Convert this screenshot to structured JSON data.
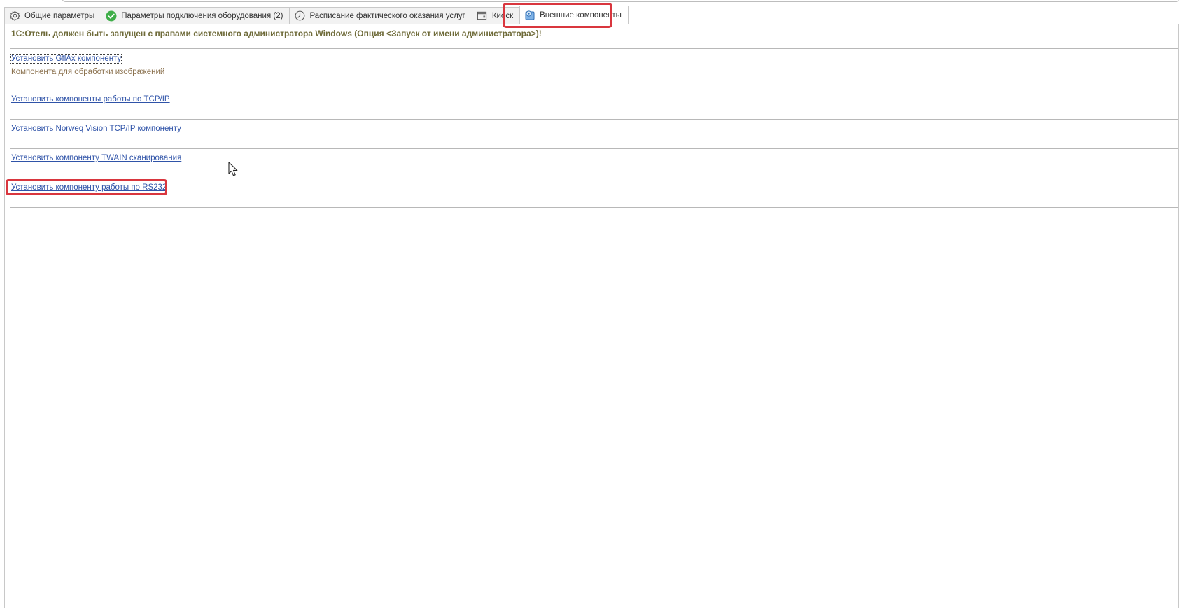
{
  "tabs": [
    {
      "label": "Общие параметры",
      "icon": "gear-icon",
      "active": false
    },
    {
      "label": "Параметры подключения оборудования (2)",
      "icon": "check-circle-icon",
      "active": false
    },
    {
      "label": "Расписание фактического оказания услуг",
      "icon": "clock-icon",
      "active": false
    },
    {
      "label": "Киоск",
      "icon": "window-icon",
      "active": false
    },
    {
      "label": "Внешние компоненты",
      "icon": "components-icon",
      "active": true
    }
  ],
  "main": {
    "warning": "1С:Отель должен быть запущен с правами системного администратора Windows (Опция <Запуск от имени администратора>)!",
    "links": [
      {
        "label": "Установить GflAx компоненту",
        "description": "Компонента для обработки изображений"
      },
      {
        "label": "Установить компоненты работы по TCP/IP",
        "description": ""
      },
      {
        "label": "Установить Norweq Vision TCP/IP компоненту",
        "description": ""
      },
      {
        "label": "Установить компоненту TWAIN сканирования",
        "description": ""
      },
      {
        "label": "Установить компоненту работы по RS232",
        "description": ""
      }
    ]
  },
  "colors": {
    "link": "#2f53a8",
    "warning": "#6e6a38",
    "description": "#8c7350",
    "highlight": "#d9363e"
  }
}
